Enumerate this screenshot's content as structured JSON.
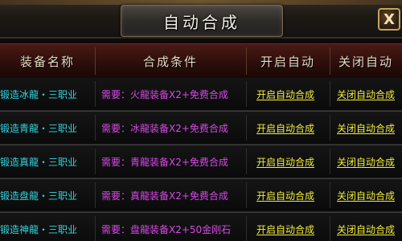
{
  "window": {
    "title": "自动合成",
    "close_label": "X"
  },
  "header": {
    "columns": [
      "装备名称",
      "合成条件",
      "开启自动",
      "关闭自动"
    ]
  },
  "rows": [
    {
      "name": "锻造冰龍・三职业",
      "condition": "需要：火龍装备X2+免费合成",
      "open": "开启自动合成",
      "close": "关闭自动合成"
    },
    {
      "name": "锻造青龍・三职业",
      "condition": "需要：冰龍装备X2+免费合成",
      "open": "开启自动合成",
      "close": "关闭自动合成"
    },
    {
      "name": "锻造真龍・三职业",
      "condition": "需要：青龍装备X2+免费合成",
      "open": "开启自动合成",
      "close": "关闭自动合成"
    },
    {
      "name": "锻造盘龍・三职业",
      "condition": "需要：真龍装备X2+免费合成",
      "open": "开启自动合成",
      "close": "关闭自动合成"
    },
    {
      "name": "锻造神龍・三职业",
      "condition": "需要：盘龍装备X2+50金刚石",
      "open": "开启自动合成",
      "close": "关闭自动合成"
    }
  ]
}
